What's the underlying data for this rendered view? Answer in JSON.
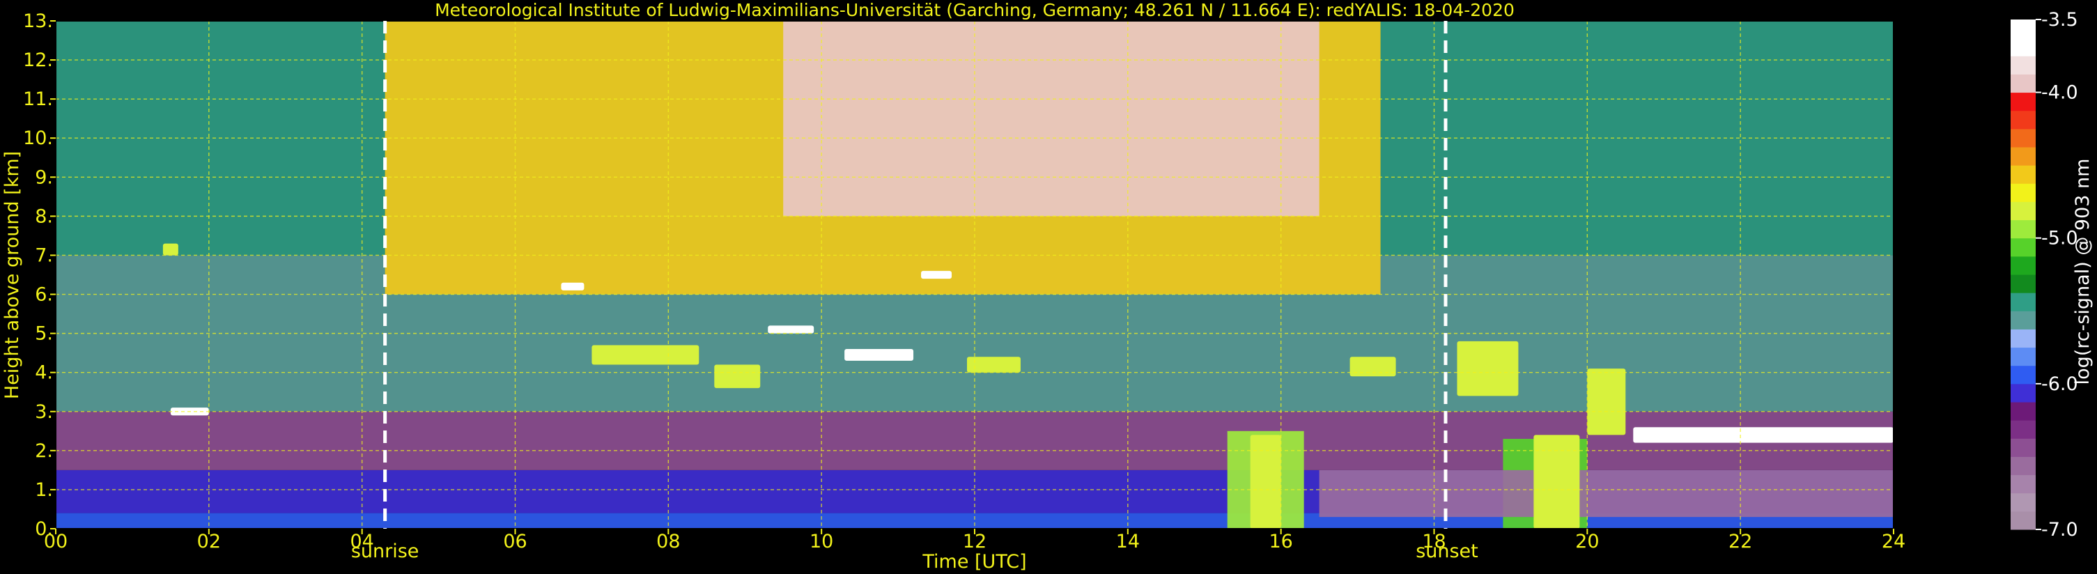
{
  "chart_data": {
    "type": "heatmap",
    "title": "Meteorological Institute of Ludwig-Maximilians-Universität (Garching, Germany; 48.261 N / 11.664 E):    redYALIS: 18-04-2020",
    "xlabel": "Time [UTC]",
    "ylabel": "Height above ground [km]",
    "xlim": [
      0,
      24
    ],
    "ylim": [
      0,
      13
    ],
    "x_ticks": [
      "00",
      "02",
      "04",
      "06",
      "08",
      "10",
      "12",
      "14",
      "16",
      "18",
      "20",
      "22",
      "24"
    ],
    "y_ticks": [
      "0.",
      "1.",
      "2.",
      "3.",
      "4.",
      "5.",
      "6.",
      "7.",
      "8.",
      "9.",
      "10.",
      "11.",
      "12.",
      "13."
    ],
    "grid": true,
    "events": [
      {
        "label": "sunrise",
        "time": 4.3
      },
      {
        "label": "sunset",
        "time": 18.15
      }
    ],
    "layers": [
      {
        "t0": 0,
        "t1": 24,
        "h0": 0,
        "h1": 0.4,
        "value": -6.0
      },
      {
        "t0": 0,
        "t1": 24,
        "h0": 0.4,
        "h1": 1.5,
        "value": -6.1
      },
      {
        "t0": 0,
        "t1": 24,
        "h0": 1.5,
        "h1": 3.0,
        "value": -6.5
      },
      {
        "t0": 0,
        "t1": 24,
        "h0": 3.0,
        "h1": 7.0,
        "value": -5.6
      },
      {
        "t0": 0,
        "t1": 24,
        "h0": 7.0,
        "h1": 13,
        "value": -5.5
      },
      {
        "t0": 4.3,
        "t1": 17.3,
        "h0": 6.0,
        "h1": 13,
        "value": -4.6
      },
      {
        "t0": 9.5,
        "t1": 16.5,
        "h0": 8.0,
        "h1": 13,
        "value": -4.0
      },
      {
        "t0": 15.3,
        "t1": 16.3,
        "h0": 0.0,
        "h1": 2.5,
        "value": -5.0
      },
      {
        "t0": 18.9,
        "t1": 20.0,
        "h0": 0.0,
        "h1": 2.3,
        "value": -5.1
      },
      {
        "t0": 16.5,
        "t1": 24,
        "h0": 0.3,
        "h1": 1.5,
        "value": -6.6
      }
    ],
    "cloud_features": [
      {
        "t0": 1.4,
        "t1": 1.6,
        "h0": 7.0,
        "h1": 7.3,
        "value": -4.8
      },
      {
        "t0": 1.5,
        "t1": 2.0,
        "h0": 2.9,
        "h1": 3.1,
        "value": -3.6
      },
      {
        "t0": 6.6,
        "t1": 6.9,
        "h0": 6.1,
        "h1": 6.3,
        "value": -3.6
      },
      {
        "t0": 7.0,
        "t1": 8.4,
        "h0": 4.2,
        "h1": 4.7,
        "value": -4.8
      },
      {
        "t0": 8.6,
        "t1": 9.2,
        "h0": 3.6,
        "h1": 4.2,
        "value": -4.8
      },
      {
        "t0": 9.3,
        "t1": 9.9,
        "h0": 5.0,
        "h1": 5.2,
        "value": -3.6
      },
      {
        "t0": 10.3,
        "t1": 11.2,
        "h0": 4.3,
        "h1": 4.6,
        "value": -3.6
      },
      {
        "t0": 11.3,
        "t1": 11.7,
        "h0": 6.4,
        "h1": 6.6,
        "value": -3.6
      },
      {
        "t0": 11.9,
        "t1": 12.6,
        "h0": 4.0,
        "h1": 4.4,
        "value": -4.8
      },
      {
        "t0": 15.6,
        "t1": 16.0,
        "h0": 0.0,
        "h1": 2.4,
        "value": -4.8
      },
      {
        "t0": 16.9,
        "t1": 17.5,
        "h0": 3.9,
        "h1": 4.4,
        "value": -4.8
      },
      {
        "t0": 18.3,
        "t1": 19.1,
        "h0": 3.4,
        "h1": 4.8,
        "value": -4.8
      },
      {
        "t0": 19.3,
        "t1": 19.9,
        "h0": 0.0,
        "h1": 2.4,
        "value": -4.8
      },
      {
        "t0": 20.0,
        "t1": 20.5,
        "h0": 2.4,
        "h1": 4.1,
        "value": -4.8
      },
      {
        "t0": 20.6,
        "t1": 24,
        "h0": 2.2,
        "h1": 2.6,
        "value": -3.6
      }
    ],
    "colorbar": {
      "label": "log(rc-signal) @ 903 nm",
      "ticks": [
        "-3.5",
        "-4.0",
        "-5.0",
        "-6.0",
        "-7.0"
      ],
      "range": [
        -7.0,
        -3.5
      ],
      "colors": [
        "#a98fa9",
        "#b097b2",
        "#a783ab",
        "#9a6c9e",
        "#8d4f93",
        "#7c2f86",
        "#6d1a78",
        "#3f2fd6",
        "#2f5cf2",
        "#5d8cf4",
        "#9ab4f7",
        "#5a9e9a",
        "#2f9e86",
        "#128a1e",
        "#1ea81e",
        "#57d22a",
        "#9eeb3c",
        "#d7f23d",
        "#f2f21a",
        "#f2c91a",
        "#f29a1a",
        "#f26a1a",
        "#f23a1a",
        "#f01515",
        "#e8c6c6",
        "#f2e0e0",
        "#ffffff",
        "#ffffff"
      ]
    }
  }
}
